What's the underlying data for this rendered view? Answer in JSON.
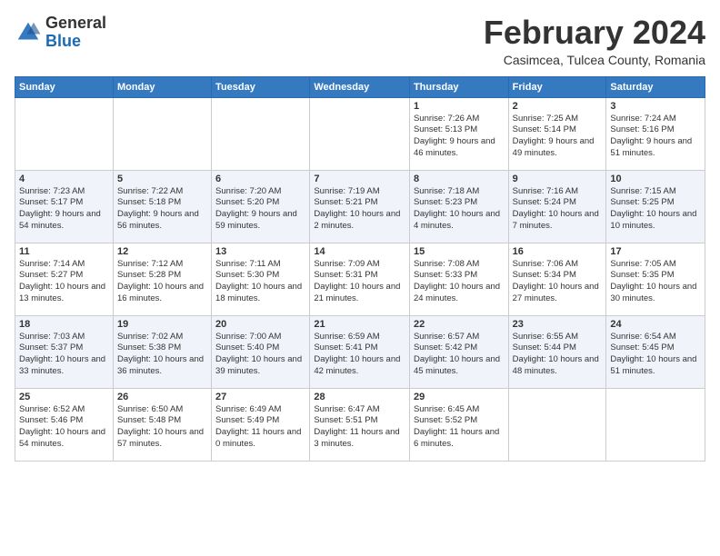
{
  "header": {
    "logo_general": "General",
    "logo_blue": "Blue",
    "month_year": "February 2024",
    "location": "Casimcea, Tulcea County, Romania"
  },
  "weekdays": [
    "Sunday",
    "Monday",
    "Tuesday",
    "Wednesday",
    "Thursday",
    "Friday",
    "Saturday"
  ],
  "weeks": [
    [
      {
        "day": "",
        "sunrise": "",
        "sunset": "",
        "daylight": ""
      },
      {
        "day": "",
        "sunrise": "",
        "sunset": "",
        "daylight": ""
      },
      {
        "day": "",
        "sunrise": "",
        "sunset": "",
        "daylight": ""
      },
      {
        "day": "",
        "sunrise": "",
        "sunset": "",
        "daylight": ""
      },
      {
        "day": "1",
        "sunrise": "Sunrise: 7:26 AM",
        "sunset": "Sunset: 5:13 PM",
        "daylight": "Daylight: 9 hours and 46 minutes."
      },
      {
        "day": "2",
        "sunrise": "Sunrise: 7:25 AM",
        "sunset": "Sunset: 5:14 PM",
        "daylight": "Daylight: 9 hours and 49 minutes."
      },
      {
        "day": "3",
        "sunrise": "Sunrise: 7:24 AM",
        "sunset": "Sunset: 5:16 PM",
        "daylight": "Daylight: 9 hours and 51 minutes."
      }
    ],
    [
      {
        "day": "4",
        "sunrise": "Sunrise: 7:23 AM",
        "sunset": "Sunset: 5:17 PM",
        "daylight": "Daylight: 9 hours and 54 minutes."
      },
      {
        "day": "5",
        "sunrise": "Sunrise: 7:22 AM",
        "sunset": "Sunset: 5:18 PM",
        "daylight": "Daylight: 9 hours and 56 minutes."
      },
      {
        "day": "6",
        "sunrise": "Sunrise: 7:20 AM",
        "sunset": "Sunset: 5:20 PM",
        "daylight": "Daylight: 9 hours and 59 minutes."
      },
      {
        "day": "7",
        "sunrise": "Sunrise: 7:19 AM",
        "sunset": "Sunset: 5:21 PM",
        "daylight": "Daylight: 10 hours and 2 minutes."
      },
      {
        "day": "8",
        "sunrise": "Sunrise: 7:18 AM",
        "sunset": "Sunset: 5:23 PM",
        "daylight": "Daylight: 10 hours and 4 minutes."
      },
      {
        "day": "9",
        "sunrise": "Sunrise: 7:16 AM",
        "sunset": "Sunset: 5:24 PM",
        "daylight": "Daylight: 10 hours and 7 minutes."
      },
      {
        "day": "10",
        "sunrise": "Sunrise: 7:15 AM",
        "sunset": "Sunset: 5:25 PM",
        "daylight": "Daylight: 10 hours and 10 minutes."
      }
    ],
    [
      {
        "day": "11",
        "sunrise": "Sunrise: 7:14 AM",
        "sunset": "Sunset: 5:27 PM",
        "daylight": "Daylight: 10 hours and 13 minutes."
      },
      {
        "day": "12",
        "sunrise": "Sunrise: 7:12 AM",
        "sunset": "Sunset: 5:28 PM",
        "daylight": "Daylight: 10 hours and 16 minutes."
      },
      {
        "day": "13",
        "sunrise": "Sunrise: 7:11 AM",
        "sunset": "Sunset: 5:30 PM",
        "daylight": "Daylight: 10 hours and 18 minutes."
      },
      {
        "day": "14",
        "sunrise": "Sunrise: 7:09 AM",
        "sunset": "Sunset: 5:31 PM",
        "daylight": "Daylight: 10 hours and 21 minutes."
      },
      {
        "day": "15",
        "sunrise": "Sunrise: 7:08 AM",
        "sunset": "Sunset: 5:33 PM",
        "daylight": "Daylight: 10 hours and 24 minutes."
      },
      {
        "day": "16",
        "sunrise": "Sunrise: 7:06 AM",
        "sunset": "Sunset: 5:34 PM",
        "daylight": "Daylight: 10 hours and 27 minutes."
      },
      {
        "day": "17",
        "sunrise": "Sunrise: 7:05 AM",
        "sunset": "Sunset: 5:35 PM",
        "daylight": "Daylight: 10 hours and 30 minutes."
      }
    ],
    [
      {
        "day": "18",
        "sunrise": "Sunrise: 7:03 AM",
        "sunset": "Sunset: 5:37 PM",
        "daylight": "Daylight: 10 hours and 33 minutes."
      },
      {
        "day": "19",
        "sunrise": "Sunrise: 7:02 AM",
        "sunset": "Sunset: 5:38 PM",
        "daylight": "Daylight: 10 hours and 36 minutes."
      },
      {
        "day": "20",
        "sunrise": "Sunrise: 7:00 AM",
        "sunset": "Sunset: 5:40 PM",
        "daylight": "Daylight: 10 hours and 39 minutes."
      },
      {
        "day": "21",
        "sunrise": "Sunrise: 6:59 AM",
        "sunset": "Sunset: 5:41 PM",
        "daylight": "Daylight: 10 hours and 42 minutes."
      },
      {
        "day": "22",
        "sunrise": "Sunrise: 6:57 AM",
        "sunset": "Sunset: 5:42 PM",
        "daylight": "Daylight: 10 hours and 45 minutes."
      },
      {
        "day": "23",
        "sunrise": "Sunrise: 6:55 AM",
        "sunset": "Sunset: 5:44 PM",
        "daylight": "Daylight: 10 hours and 48 minutes."
      },
      {
        "day": "24",
        "sunrise": "Sunrise: 6:54 AM",
        "sunset": "Sunset: 5:45 PM",
        "daylight": "Daylight: 10 hours and 51 minutes."
      }
    ],
    [
      {
        "day": "25",
        "sunrise": "Sunrise: 6:52 AM",
        "sunset": "Sunset: 5:46 PM",
        "daylight": "Daylight: 10 hours and 54 minutes."
      },
      {
        "day": "26",
        "sunrise": "Sunrise: 6:50 AM",
        "sunset": "Sunset: 5:48 PM",
        "daylight": "Daylight: 10 hours and 57 minutes."
      },
      {
        "day": "27",
        "sunrise": "Sunrise: 6:49 AM",
        "sunset": "Sunset: 5:49 PM",
        "daylight": "Daylight: 11 hours and 0 minutes."
      },
      {
        "day": "28",
        "sunrise": "Sunrise: 6:47 AM",
        "sunset": "Sunset: 5:51 PM",
        "daylight": "Daylight: 11 hours and 3 minutes."
      },
      {
        "day": "29",
        "sunrise": "Sunrise: 6:45 AM",
        "sunset": "Sunset: 5:52 PM",
        "daylight": "Daylight: 11 hours and 6 minutes."
      },
      {
        "day": "",
        "sunrise": "",
        "sunset": "",
        "daylight": ""
      },
      {
        "day": "",
        "sunrise": "",
        "sunset": "",
        "daylight": ""
      }
    ]
  ]
}
